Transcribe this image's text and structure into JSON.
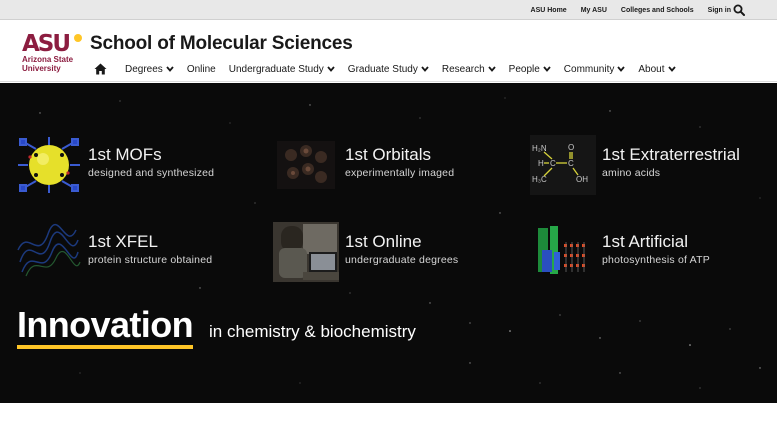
{
  "utility": {
    "links": [
      "ASU Home",
      "My ASU",
      "Colleges and Schools",
      "Sign in"
    ],
    "search_icon": "search-icon"
  },
  "header": {
    "logo": {
      "mark": "ASU",
      "line1": "Arizona State",
      "line2": "University",
      "colors": {
        "maroon": "#8c1d40",
        "gold": "#ffc627"
      }
    },
    "title": "School of Molecular Sciences"
  },
  "nav": {
    "home_icon": "home-icon",
    "items": [
      {
        "label": "Degrees",
        "has_menu": true
      },
      {
        "label": "Online",
        "has_menu": false
      },
      {
        "label": "Undergraduate Study",
        "has_menu": true
      },
      {
        "label": "Graduate Study",
        "has_menu": true
      },
      {
        "label": "Research",
        "has_menu": true
      },
      {
        "label": "People",
        "has_menu": true
      },
      {
        "label": "Community",
        "has_menu": true
      },
      {
        "label": "About",
        "has_menu": true
      }
    ]
  },
  "hero": {
    "tiles": [
      {
        "title": "1st MOFs",
        "subtitle": "designed and synthesized",
        "image": "mof-structure-image"
      },
      {
        "title": "1st Orbitals",
        "subtitle": "experimentally imaged",
        "image": "orbitals-image"
      },
      {
        "title": "1st Extraterrestrial",
        "subtitle": "amino acids",
        "image": "amino-acid-structure-image"
      },
      {
        "title": "1st XFEL",
        "subtitle": "protein structure obtained",
        "image": "protein-structure-image"
      },
      {
        "title": "1st Online",
        "subtitle": "undergraduate degrees",
        "image": "online-student-image"
      },
      {
        "title": "1st Artificial",
        "subtitle": "photosynthesis of ATP",
        "image": "photosynthesis-image"
      }
    ],
    "tagline_main": "Innovation",
    "tagline_rest": "in chemistry & biochemistry",
    "amino_labels": {
      "h2n": "H₂N",
      "h": "H",
      "c1": "C",
      "c2": "C",
      "o": "O",
      "h3c": "H₃C",
      "oh": "OH"
    },
    "accent": "#ffc627",
    "background": "#0a0a0a"
  }
}
